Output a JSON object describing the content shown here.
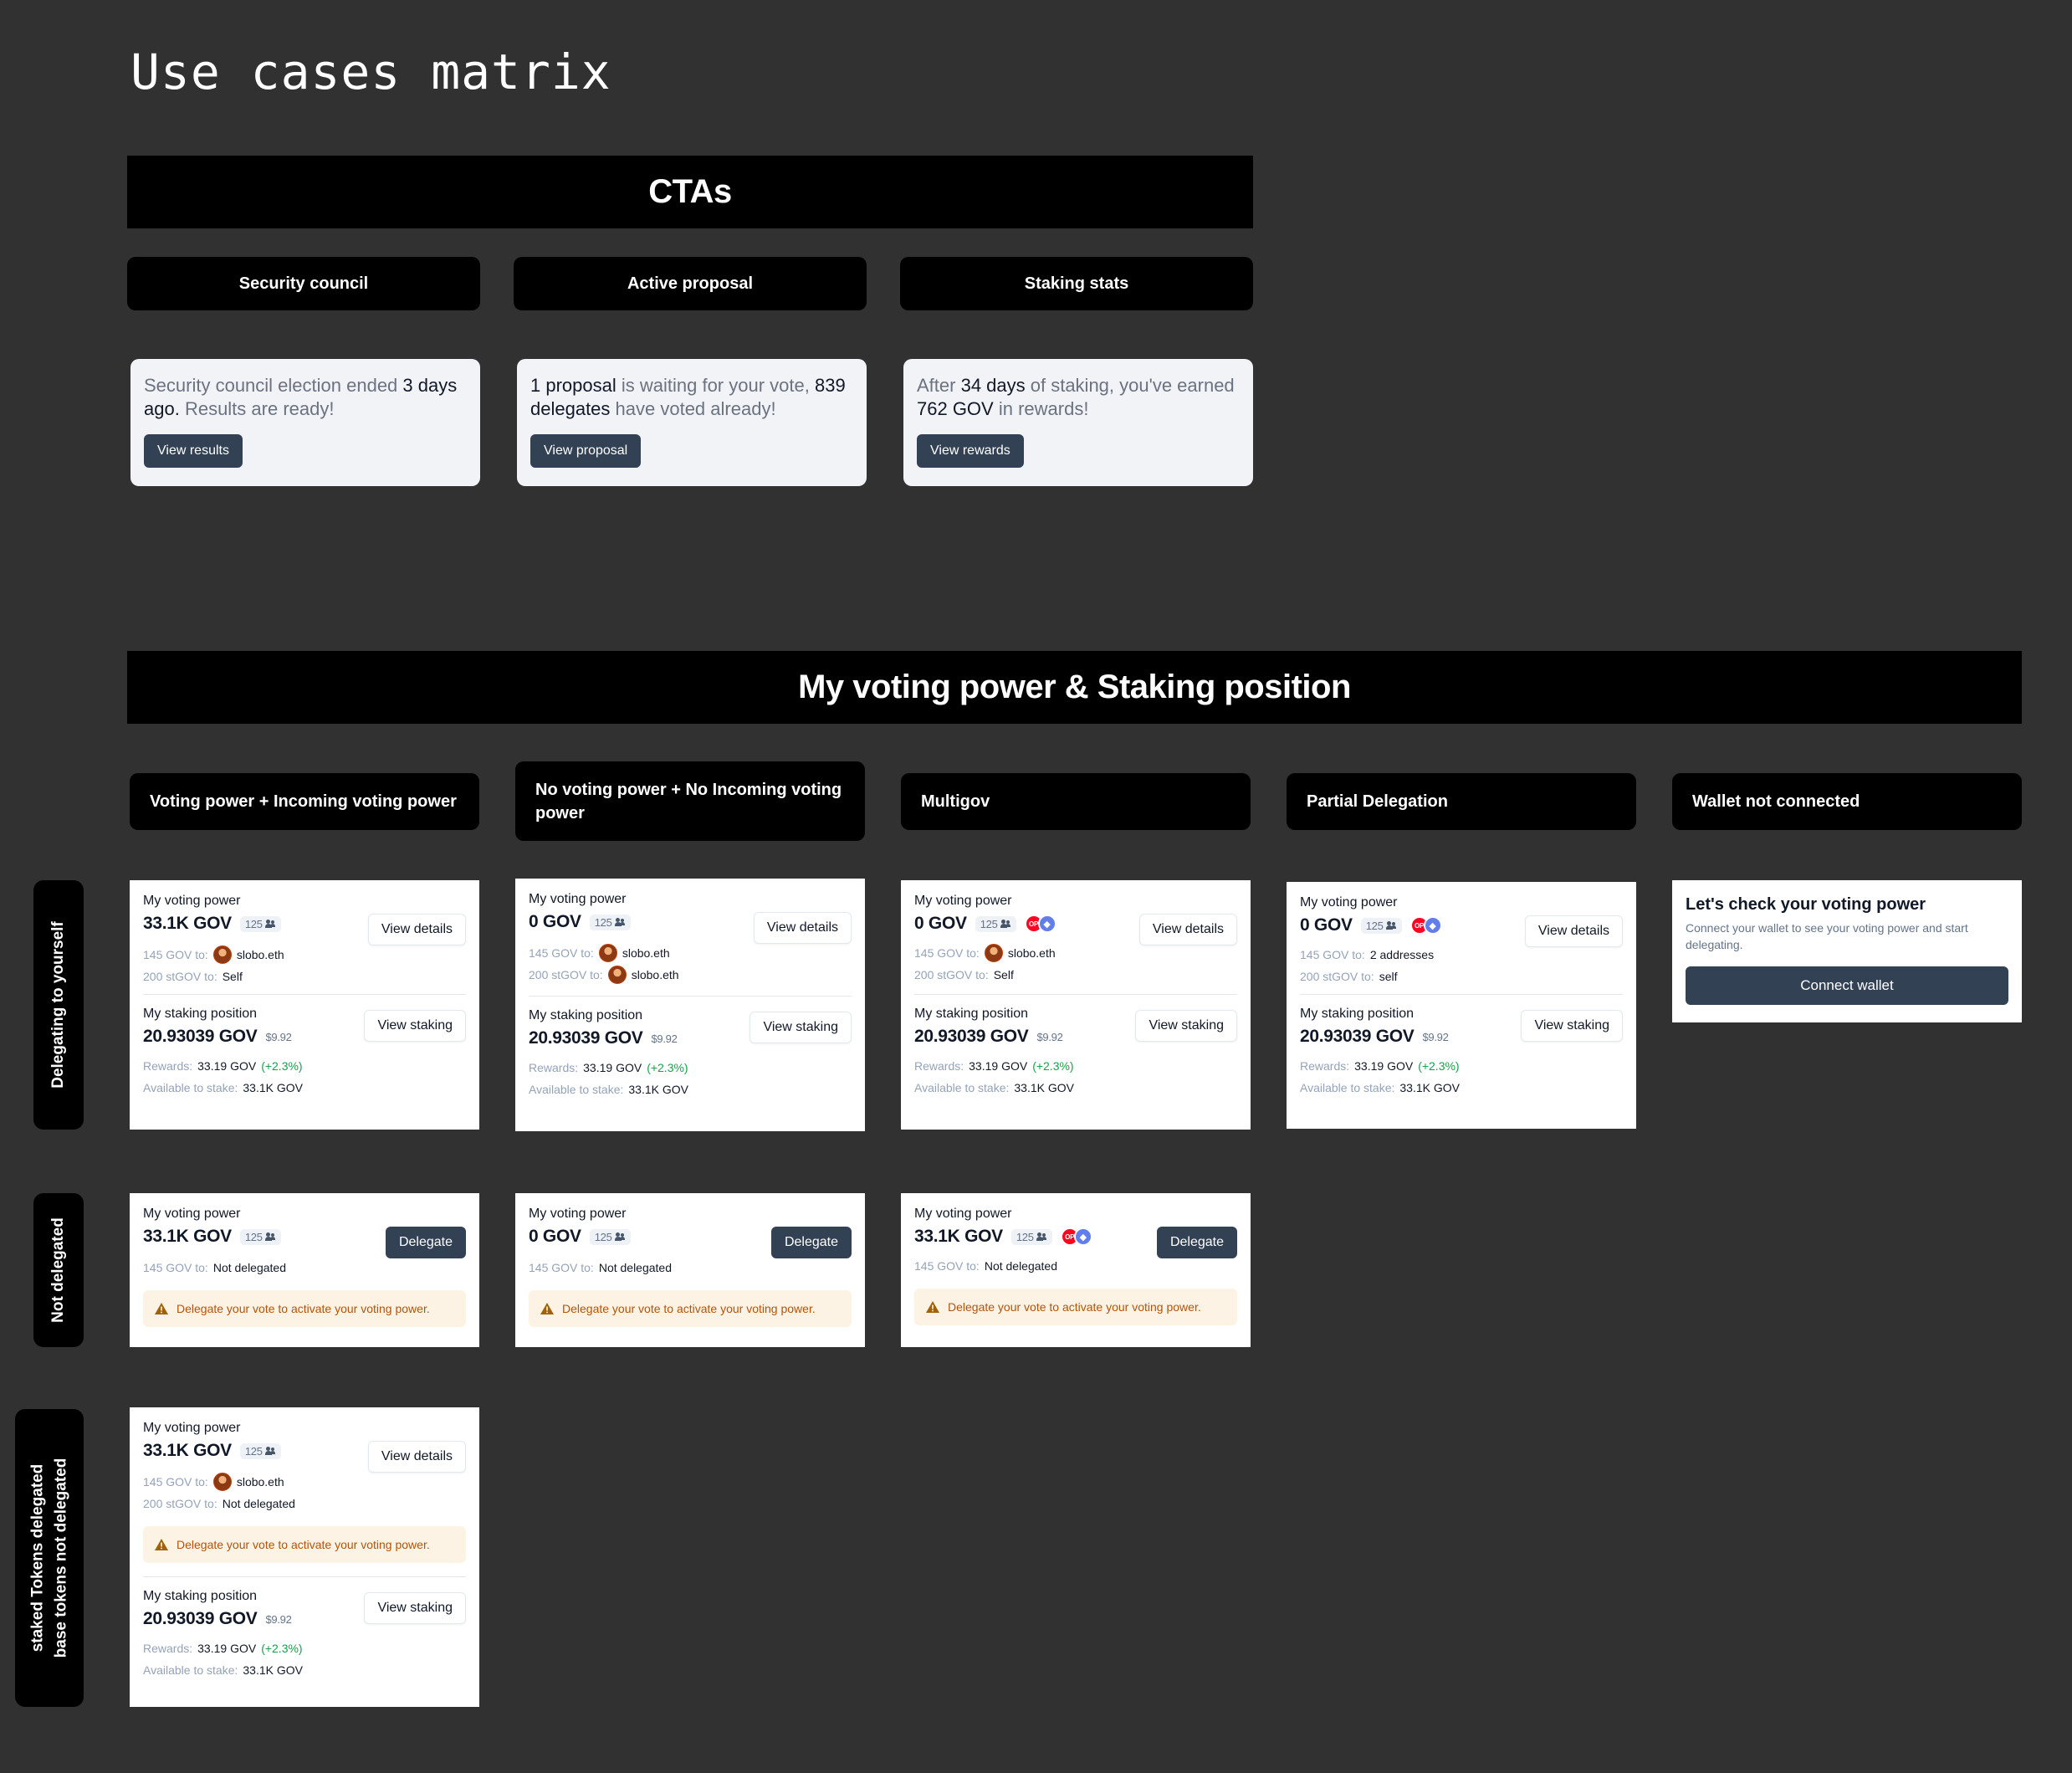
{
  "title": "Use cases matrix",
  "ctas": {
    "banner": "CTAs",
    "columns": [
      "Security council",
      "Active proposal",
      "Staking stats"
    ],
    "cards": [
      {
        "segments": [
          {
            "t": "Security council election ended ",
            "b": false
          },
          {
            "t": "3 days ago.",
            "b": true
          },
          {
            "t": " Results are ready!",
            "b": false
          }
        ],
        "button": "View results"
      },
      {
        "segments": [
          {
            "t": "1 proposal",
            "b": true
          },
          {
            "t": " is waiting for your vote, ",
            "b": false
          },
          {
            "t": "839 delegates",
            "b": true
          },
          {
            "t": " have voted already!",
            "b": false
          }
        ],
        "button": "View proposal"
      },
      {
        "segments": [
          {
            "t": "After ",
            "b": false
          },
          {
            "t": "34 days",
            "b": true
          },
          {
            "t": " of staking, you've earned ",
            "b": false
          },
          {
            "t": "762 GOV",
            "b": true
          },
          {
            "t": " in rewards!",
            "b": false
          }
        ],
        "button": "View rewards"
      }
    ]
  },
  "matrix": {
    "banner": "My voting power & Staking position",
    "columns": [
      "Voting power + Incoming voting power",
      "No voting power + No Incoming voting power",
      "Multigov",
      "Partial Delegation",
      "Wallet not connected"
    ],
    "rows": [
      "Delegating to yourself",
      "Not delegated",
      "staked Tokens delegated\nbase tokens not delegated"
    ],
    "labels": {
      "voting_power": "My voting power",
      "staking_position": "My staking position",
      "view_details": "View details",
      "view_staking": "View staking",
      "delegate": "Delegate",
      "gov_to": "145 GOV to:",
      "stgov_to": "200 stGOV to:",
      "rewards": "Rewards:",
      "available": "Available to stake:",
      "warning": "Delegate your vote to activate your voting power.",
      "delegators": "125"
    },
    "values": {
      "vp_full": "33.1K GOV",
      "vp_zero": "0 GOV",
      "stake_amount": "20.93039 GOV",
      "stake_usd": "$9.92",
      "rewards_amount": "33.19 GOV",
      "rewards_pct": "(+2.3%)",
      "available_amount": "33.1K GOV",
      "ens": "slobo.eth",
      "self_cap": "Self",
      "self_lower": "self",
      "two_addresses": "2 addresses",
      "not_delegated": "Not delegated"
    },
    "wallet": {
      "title": "Let's check your voting power",
      "description": "Connect your wallet to see your voting power and start delegating.",
      "button": "Connect wallet"
    }
  },
  "icons": [
    "people-icon",
    "avatar-icon",
    "op-token-icon",
    "eth-token-icon",
    "warning-icon"
  ],
  "colors": {
    "background": "#313131",
    "banner": "#000000",
    "button_dark": "#334155",
    "warning_bg": "#fdf3e4",
    "warning_text": "#b45309",
    "positive": "#16a34a"
  }
}
